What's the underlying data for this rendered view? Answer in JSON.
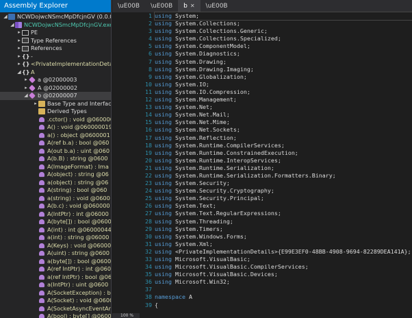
{
  "explorer": {
    "title": "Assembly Explorer",
    "nodes": [
      {
        "expand": "◢",
        "icon": "assembly-icon",
        "icon_class": "i-asm",
        "indent": 4,
        "text": "NCWDojwcNSmcMpDfcjnGV (0.0.0.0",
        "tone": "lbl"
      },
      {
        "expand": "◢",
        "icon": "module-icon",
        "icon_class": "i-mod",
        "indent": 14,
        "text": "NCWDojwcNSmcMpDfcjnGV.exe",
        "tone": "tok"
      },
      {
        "expand": "▸",
        "icon": "pe-icon",
        "icon_class": "i-sq",
        "indent": 24,
        "text": "PE",
        "tone": "lbl"
      },
      {
        "expand": "▸",
        "icon": "type-references-icon",
        "icon_class": "i-ref",
        "indent": 24,
        "text": "Type References",
        "tone": "lbl"
      },
      {
        "expand": "▸",
        "icon": "references-icon",
        "icon_class": "i-ref",
        "indent": 24,
        "text": "References",
        "tone": "lbl"
      },
      {
        "expand": "▸",
        "icon": "namespace-icon",
        "icon_class": "i-brace",
        "glyph": "{}",
        "indent": 24,
        "text": "-",
        "tone": "lbl"
      },
      {
        "expand": "▸",
        "icon": "namespace-icon",
        "icon_class": "i-brace",
        "glyph": "{}",
        "indent": 24,
        "text": "<PrivateImplementationDeta",
        "tone": "yel"
      },
      {
        "expand": "◢",
        "icon": "namespace-icon",
        "icon_class": "i-brace",
        "glyph": "{}",
        "indent": 24,
        "text": "A",
        "tone": "yel"
      },
      {
        "expand": "▸",
        "icon": "class-icon",
        "icon_class": "i-cls",
        "indent": 34,
        "text": "a @02000003",
        "tone": "lbl"
      },
      {
        "expand": "▸",
        "icon": "class-icon",
        "icon_class": "i-cls",
        "indent": 34,
        "text": "A @02000002",
        "tone": "lbl"
      },
      {
        "expand": "◢",
        "icon": "class-icon",
        "icon_class": "i-cls",
        "indent": 34,
        "text": "b @02000007",
        "tone": "lbl",
        "selected": true
      },
      {
        "expand": "▸",
        "icon": "folder-icon",
        "icon_class": "i-folder",
        "indent": 48,
        "text": "Base Type and Interfac",
        "tone": "lbl"
      },
      {
        "expand": "",
        "icon": "folder-icon",
        "icon_class": "i-folder",
        "indent": 48,
        "text": "Derived Types",
        "tone": "lbl"
      },
      {
        "expand": "",
        "icon": "method-icon",
        "icon_class": "i-meth",
        "indent": 48,
        "text": ".cctor() : void @060000",
        "tone": "yel"
      },
      {
        "expand": "",
        "icon": "method-icon",
        "icon_class": "i-meth",
        "indent": 48,
        "text": "A() : void @060000019",
        "tone": "yel"
      },
      {
        "expand": "",
        "icon": "method-icon",
        "icon_class": "i-meth",
        "indent": 48,
        "text": "a() : object @0600001",
        "tone": "yel"
      },
      {
        "expand": "",
        "icon": "method-icon",
        "icon_class": "i-meth",
        "indent": 48,
        "text": "A(ref b.a) : bool @060",
        "tone": "yel"
      },
      {
        "expand": "",
        "icon": "method-icon",
        "icon_class": "i-meth",
        "indent": 48,
        "text": "A(out b.a) : uint @060",
        "tone": "yel"
      },
      {
        "expand": "",
        "icon": "method-icon",
        "icon_class": "i-meth",
        "indent": 48,
        "text": "A(b.B) : string @0600",
        "tone": "yel"
      },
      {
        "expand": "",
        "icon": "method-icon",
        "icon_class": "i-meth",
        "indent": 48,
        "text": "A(ImageFormat) : Ima",
        "tone": "yel"
      },
      {
        "expand": "",
        "icon": "method-icon",
        "icon_class": "i-meth",
        "indent": 48,
        "text": "A(object) : string @06",
        "tone": "yel"
      },
      {
        "expand": "",
        "icon": "method-icon",
        "icon_class": "i-meth",
        "indent": 48,
        "text": "a(object) : string @06",
        "tone": "yel"
      },
      {
        "expand": "",
        "icon": "method-icon",
        "icon_class": "i-meth",
        "indent": 48,
        "text": "A(string) : bool @060",
        "tone": "yel"
      },
      {
        "expand": "",
        "icon": "method-icon",
        "icon_class": "i-meth",
        "indent": 48,
        "text": "a(string) : void @0600",
        "tone": "yel"
      },
      {
        "expand": "",
        "icon": "method-icon",
        "icon_class": "i-meth",
        "indent": 48,
        "text": "A(b.c) : void @060000",
        "tone": "yel"
      },
      {
        "expand": "",
        "icon": "method-icon",
        "icon_class": "i-meth",
        "indent": 48,
        "text": "A(IntPtr) : int @06000",
        "tone": "yel"
      },
      {
        "expand": "",
        "icon": "method-icon",
        "icon_class": "i-meth",
        "indent": 48,
        "text": "A(byte[]) : bool @0600",
        "tone": "yel"
      },
      {
        "expand": "",
        "icon": "method-icon",
        "icon_class": "i-meth",
        "indent": 48,
        "text": "A(int) : int @06000044",
        "tone": "yel"
      },
      {
        "expand": "",
        "icon": "method-icon",
        "icon_class": "i-meth",
        "indent": 48,
        "text": "a(int) : string @06000",
        "tone": "yel"
      },
      {
        "expand": "",
        "icon": "method-icon",
        "icon_class": "i-meth",
        "indent": 48,
        "text": "A(Keys) : void @06000",
        "tone": "yel"
      },
      {
        "expand": "",
        "icon": "method-icon",
        "icon_class": "i-meth",
        "indent": 48,
        "text": "A(uint) : string @0600",
        "tone": "yel"
      },
      {
        "expand": "",
        "icon": "method-icon",
        "icon_class": "i-meth",
        "indent": 48,
        "text": "a(byte[]) : bool @0600",
        "tone": "yel"
      },
      {
        "expand": "",
        "icon": "method-icon",
        "icon_class": "i-meth",
        "indent": 48,
        "text": "A(ref IntPtr) : int @060",
        "tone": "yel"
      },
      {
        "expand": "",
        "icon": "method-icon",
        "icon_class": "i-meth",
        "indent": 48,
        "text": "a(ref IntPtr) : bool @06",
        "tone": "yel"
      },
      {
        "expand": "",
        "icon": "method-icon",
        "icon_class": "i-meth",
        "indent": 48,
        "text": "a(IntPtr) : uint @0600",
        "tone": "yel"
      },
      {
        "expand": "",
        "icon": "method-icon",
        "icon_class": "i-meth",
        "indent": 48,
        "text": "A(SocketException) : b",
        "tone": "yel"
      },
      {
        "expand": "",
        "icon": "method-icon",
        "icon_class": "i-meth",
        "indent": 48,
        "text": "A(Socket) : void @0600",
        "tone": "yel"
      },
      {
        "expand": "",
        "icon": "method-icon",
        "icon_class": "i-meth",
        "indent": 48,
        "text": "A(SocketAsyncEventAr",
        "tone": "yel"
      },
      {
        "expand": "",
        "icon": "method-icon",
        "icon_class": "i-meth",
        "indent": 48,
        "text": "A(bool) : byte[] @0600",
        "tone": "yel"
      }
    ]
  },
  "tabs": [
    {
      "label": "\\uE00B",
      "active": false,
      "closable": false
    },
    {
      "label": "\\uE00B",
      "active": false,
      "closable": false
    },
    {
      "label": "b",
      "active": true,
      "closable": true
    },
    {
      "label": "\\uE00B",
      "active": false,
      "closable": false
    }
  ],
  "editor": {
    "lines": [
      {
        "n": "1",
        "kw": "using",
        "rest": " System;"
      },
      {
        "n": "2",
        "kw": "using",
        "rest": " System.Collections;"
      },
      {
        "n": "3",
        "kw": "using",
        "rest": " System.Collections.Generic;"
      },
      {
        "n": "4",
        "kw": "using",
        "rest": " System.Collections.Specialized;"
      },
      {
        "n": "5",
        "kw": "using",
        "rest": " System.ComponentModel;"
      },
      {
        "n": "6",
        "kw": "using",
        "rest": " System.Diagnostics;"
      },
      {
        "n": "7",
        "kw": "using",
        "rest": " System.Drawing;"
      },
      {
        "n": "8",
        "kw": "using",
        "rest": " System.Drawing.Imaging;"
      },
      {
        "n": "9",
        "kw": "using",
        "rest": " System.Globalization;"
      },
      {
        "n": "10",
        "kw": "using",
        "rest": " System.IO;"
      },
      {
        "n": "11",
        "kw": "using",
        "rest": " System.IO.Compression;"
      },
      {
        "n": "12",
        "kw": "using",
        "rest": " System.Management;"
      },
      {
        "n": "13",
        "kw": "using",
        "rest": " System.Net;"
      },
      {
        "n": "14",
        "kw": "using",
        "rest": " System.Net.Mail;"
      },
      {
        "n": "15",
        "kw": "using",
        "rest": " System.Net.Mime;"
      },
      {
        "n": "16",
        "kw": "using",
        "rest": " System.Net.Sockets;"
      },
      {
        "n": "17",
        "kw": "using",
        "rest": " System.Reflection;"
      },
      {
        "n": "18",
        "kw": "using",
        "rest": " System.Runtime.CompilerServices;"
      },
      {
        "n": "19",
        "kw": "using",
        "rest": " System.Runtime.ConstrainedExecution;"
      },
      {
        "n": "20",
        "kw": "using",
        "rest": " System.Runtime.InteropServices;"
      },
      {
        "n": "21",
        "kw": "using",
        "rest": " System.Runtime.Serialization;"
      },
      {
        "n": "22",
        "kw": "using",
        "rest": " System.Runtime.Serialization.Formatters.Binary;"
      },
      {
        "n": "23",
        "kw": "using",
        "rest": " System.Security;"
      },
      {
        "n": "24",
        "kw": "using",
        "rest": " System.Security.Cryptography;"
      },
      {
        "n": "25",
        "kw": "using",
        "rest": " System.Security.Principal;"
      },
      {
        "n": "26",
        "kw": "using",
        "rest": " System.Text;"
      },
      {
        "n": "27",
        "kw": "using",
        "rest": " System.Text.RegularExpressions;"
      },
      {
        "n": "28",
        "kw": "using",
        "rest": " System.Threading;"
      },
      {
        "n": "29",
        "kw": "using",
        "rest": " System.Timers;"
      },
      {
        "n": "30",
        "kw": "using",
        "rest": " System.Windows.Forms;"
      },
      {
        "n": "31",
        "kw": "using",
        "rest": " System.Xml;"
      },
      {
        "n": "32",
        "kw": "using",
        "rest": " <PrivateImplementationDetails>{E99E3EF0-48BB-4908-9694-82289DEA141A};"
      },
      {
        "n": "33",
        "kw": "using",
        "rest": " Microsoft.VisualBasic;"
      },
      {
        "n": "34",
        "kw": "using",
        "rest": " Microsoft.VisualBasic.CompilerServices;"
      },
      {
        "n": "35",
        "kw": "using",
        "rest": " Microsoft.VisualBasic.Devices;"
      },
      {
        "n": "36",
        "kw": "using",
        "rest": " Microsoft.Win32;"
      },
      {
        "n": "37",
        "kw": "",
        "rest": ""
      },
      {
        "n": "38",
        "kw": "namespace",
        "rest": " A"
      },
      {
        "n": "39",
        "kw": "",
        "rest": "{"
      }
    ]
  },
  "status": {
    "zoom": "100 %"
  }
}
